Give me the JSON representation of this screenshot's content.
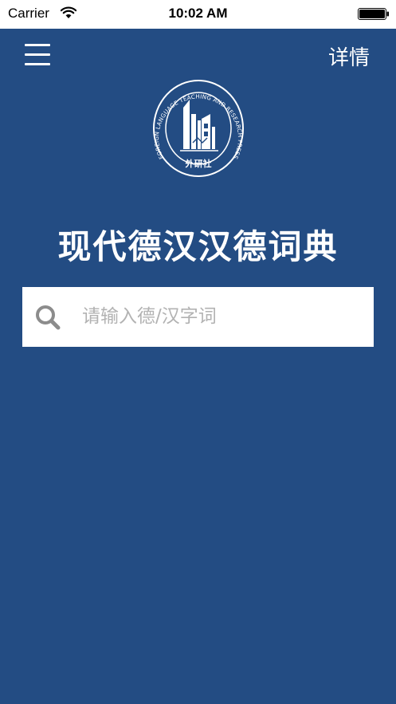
{
  "colors": {
    "background": "#234c83",
    "status_bar": "#ffffff",
    "search_box": "#ffffff",
    "placeholder": "#b2b2b2",
    "search_icon": "#8c8c8c"
  },
  "status_bar": {
    "carrier": "Carrier",
    "time": "10:02 AM",
    "icons": [
      "wifi-icon",
      "battery-icon"
    ]
  },
  "nav": {
    "menu_icon": "hamburger-menu-icon",
    "details_label": "详情"
  },
  "logo": {
    "ring_text": "FOREIGN LANGUAGE TEACHING AND RESEARCH PRESS",
    "bottom_text": "外研社"
  },
  "main": {
    "title": "现代德汉汉德词典"
  },
  "search": {
    "icon": "search-icon",
    "placeholder": "请输入德/汉字词",
    "value": ""
  }
}
